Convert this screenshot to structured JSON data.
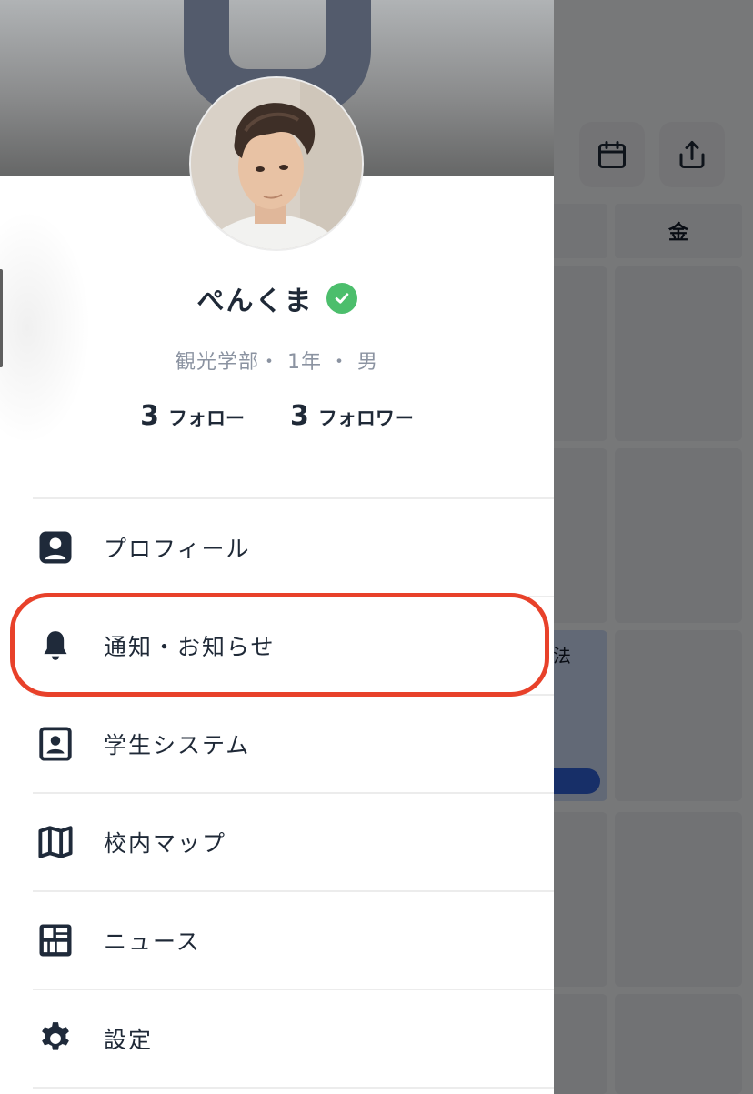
{
  "background": {
    "day_header_fri": "金",
    "course_title_fragment": "法"
  },
  "profile": {
    "name": "ぺんくま",
    "meta": "観光学部・ 1年 ・ 男",
    "follow_count": "3",
    "follow_label": "フォロー",
    "follower_count": "3",
    "follower_label": "フォロワー"
  },
  "menu": {
    "items": [
      {
        "label": "プロフィール",
        "icon": "profile-card-icon"
      },
      {
        "label": "通知・お知らせ",
        "icon": "bell-icon"
      },
      {
        "label": "学生システム",
        "icon": "id-card-icon"
      },
      {
        "label": "校内マップ",
        "icon": "map-icon"
      },
      {
        "label": "ニュース",
        "icon": "news-grid-icon"
      },
      {
        "label": "設定",
        "icon": "gear-icon"
      }
    ]
  },
  "colors": {
    "highlight": "#e8412a",
    "verified": "#4cbe6c",
    "text_primary": "#1f2937",
    "text_muted": "#8b93a1"
  }
}
